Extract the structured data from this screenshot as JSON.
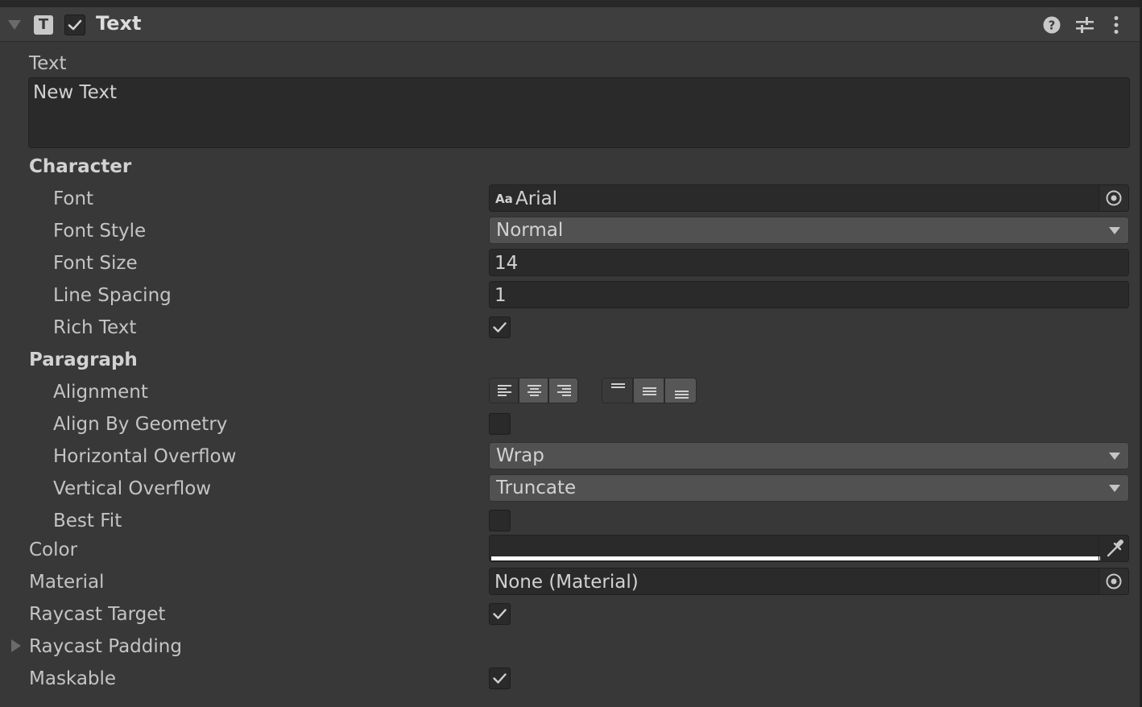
{
  "header": {
    "component_icon_letter": "T",
    "title": "Text",
    "enabled": true,
    "icons": [
      "help-icon",
      "preset-sliders-icon",
      "kebab-menu-icon"
    ]
  },
  "text_section": {
    "label": "Text",
    "value": "New Text"
  },
  "character": {
    "heading": "Character",
    "font_label": "Font",
    "font_icon_text": "Aa",
    "font_value": "Arial",
    "font_style_label": "Font Style",
    "font_style_value": "Normal",
    "font_size_label": "Font Size",
    "font_size_value": "14",
    "line_spacing_label": "Line Spacing",
    "line_spacing_value": "1",
    "rich_text_label": "Rich Text",
    "rich_text_checked": true
  },
  "paragraph": {
    "heading": "Paragraph",
    "alignment_label": "Alignment",
    "horizontal_alignment": "left",
    "vertical_alignment": "top",
    "align_by_geometry_label": "Align By Geometry",
    "align_by_geometry_checked": false,
    "horizontal_overflow_label": "Horizontal Overflow",
    "horizontal_overflow_value": "Wrap",
    "vertical_overflow_label": "Vertical Overflow",
    "vertical_overflow_value": "Truncate",
    "best_fit_label": "Best Fit",
    "best_fit_checked": false
  },
  "color": {
    "label": "Color",
    "value_hex": "#ffffff"
  },
  "material": {
    "label": "Material",
    "value": "None (Material)"
  },
  "raycast_target": {
    "label": "Raycast Target",
    "checked": true
  },
  "raycast_padding": {
    "label": "Raycast Padding",
    "expanded": false
  },
  "maskable": {
    "label": "Maskable",
    "checked": true
  }
}
